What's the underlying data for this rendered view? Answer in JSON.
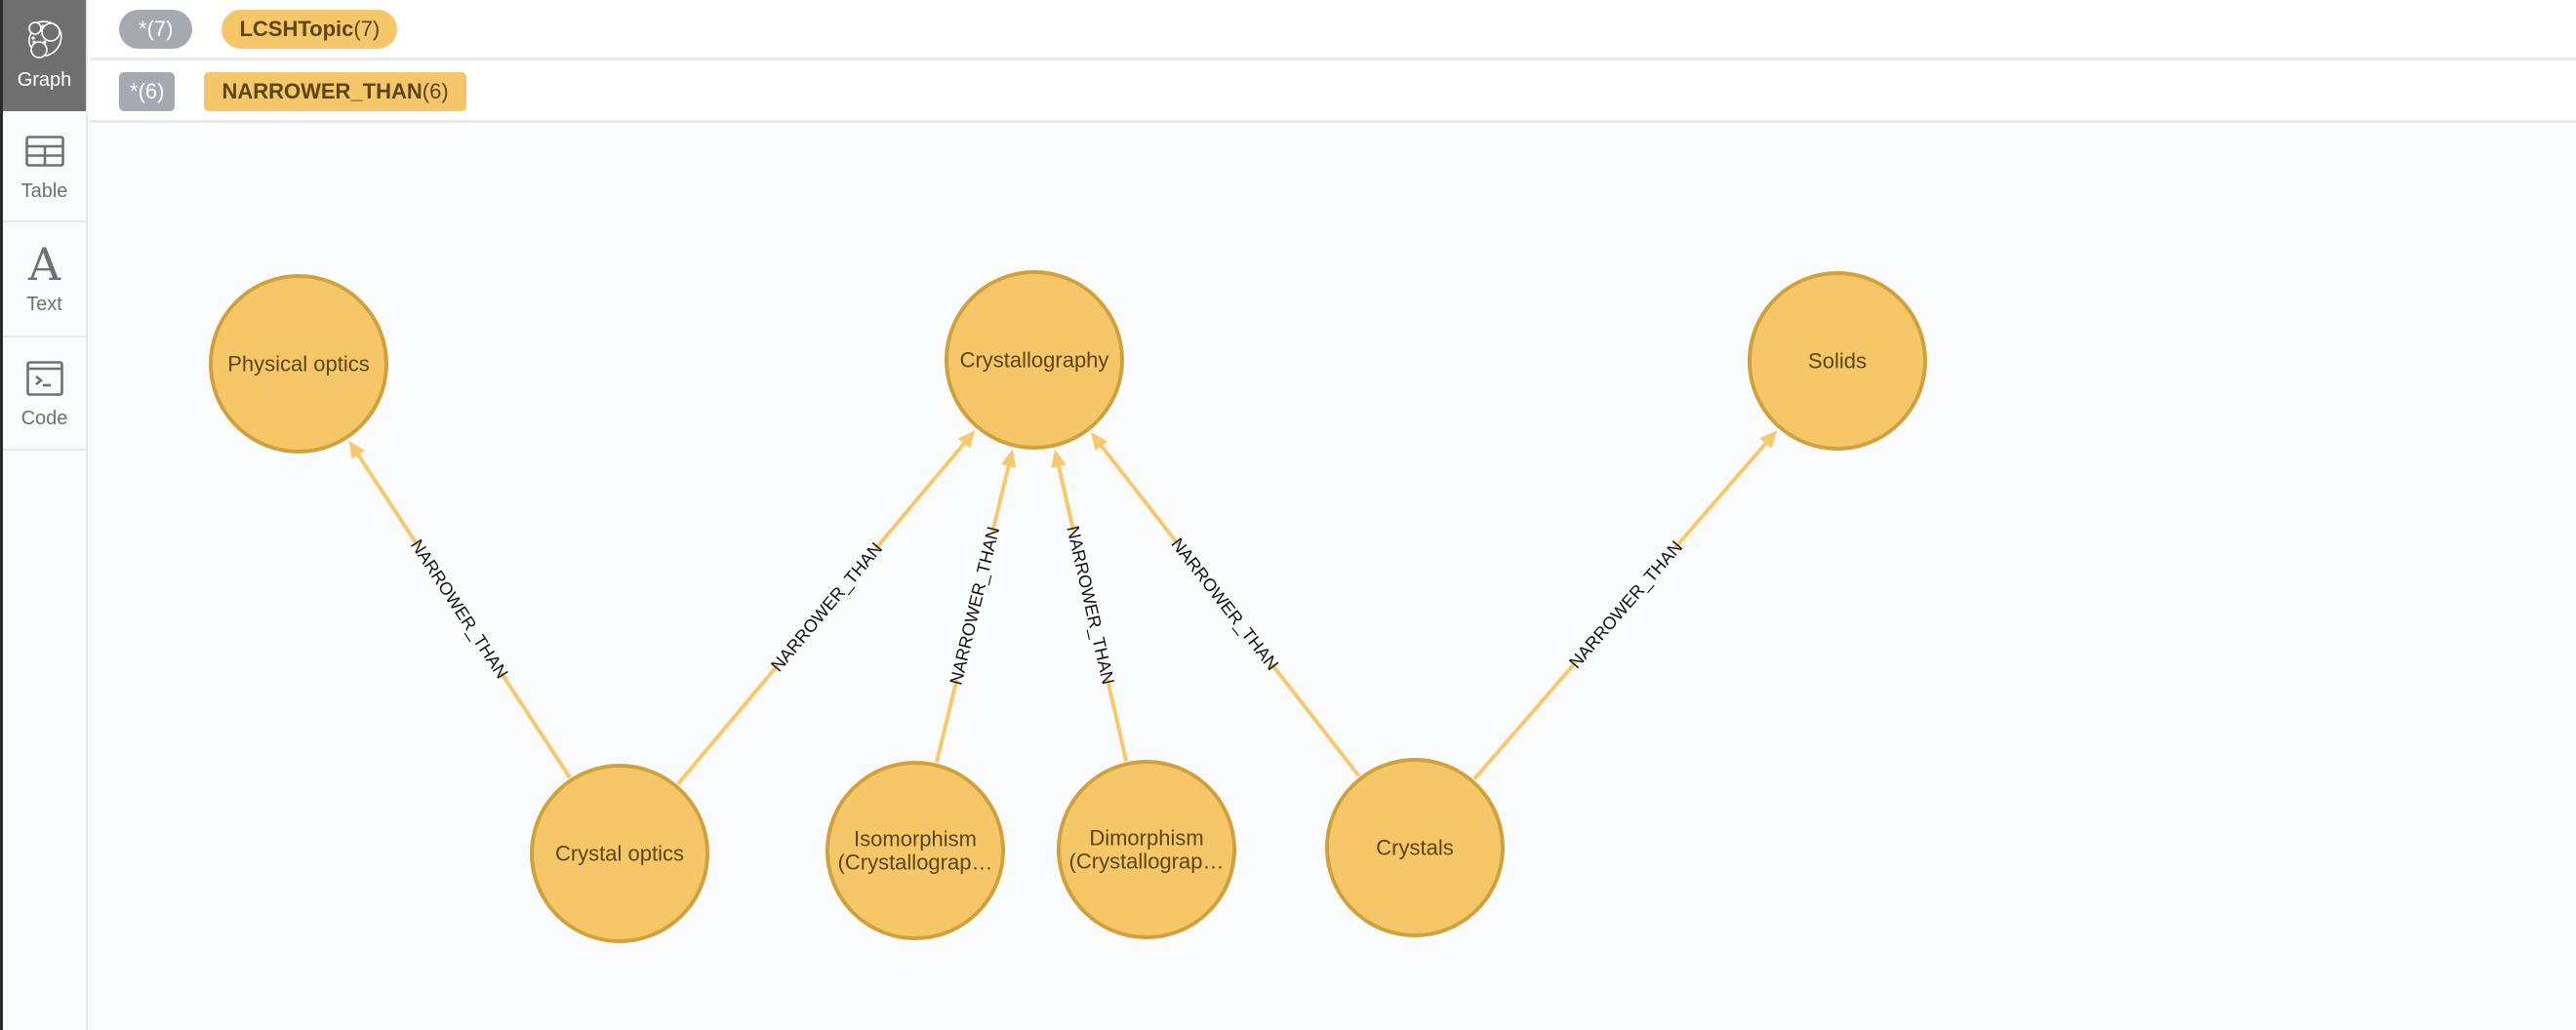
{
  "sidebar": {
    "items": [
      {
        "id": "graph",
        "label": "Graph",
        "icon": "graph-icon",
        "active": true
      },
      {
        "id": "table",
        "label": "Table",
        "icon": "table-icon",
        "active": false
      },
      {
        "id": "text",
        "label": "Text",
        "icon": "text-icon",
        "glyph": "A",
        "active": false
      },
      {
        "id": "code",
        "label": "Code",
        "icon": "code-icon",
        "active": false
      }
    ]
  },
  "header": {
    "node_labels": {
      "all": {
        "label": "*",
        "count": "(7)"
      },
      "items": [
        {
          "label": "LCSHTopic",
          "count": "(7)"
        }
      ]
    },
    "relationship_types": {
      "all": {
        "label": "*",
        "count": "(6)"
      },
      "items": [
        {
          "label": "NARROWER_THAN",
          "count": "(6)"
        }
      ]
    }
  },
  "colors": {
    "node_fill": "#f6c768",
    "node_stroke": "#d1a23b",
    "node_text": "#5a4614",
    "edge": "#f7c96c",
    "edge_text": "#111111",
    "pill_gray": "#a5a9b2",
    "sidebar_active": "#6f6f6f"
  },
  "graph": {
    "nodes": [
      {
        "id": "physical-optics",
        "label": "Physical optics",
        "lines": [
          "Physical optics"
        ]
      },
      {
        "id": "crystallography",
        "label": "Crystallography",
        "lines": [
          "Crystallography"
        ]
      },
      {
        "id": "solids",
        "label": "Solids",
        "lines": [
          "Solids"
        ]
      },
      {
        "id": "crystal-optics",
        "label": "Crystal optics",
        "lines": [
          "Crystal optics"
        ]
      },
      {
        "id": "isomorphism",
        "label": "Isomorphism (Crystallography)",
        "lines": [
          "Isomorphism",
          "(Crystallograp…"
        ]
      },
      {
        "id": "dimorphism",
        "label": "Dimorphism (Crystallography)",
        "lines": [
          "Dimorphism",
          "(Crystallograp…"
        ]
      },
      {
        "id": "crystals",
        "label": "Crystals",
        "lines": [
          "Crystals"
        ]
      }
    ],
    "edges": [
      {
        "from": "crystal-optics",
        "to": "physical-optics",
        "type": "NARROWER_THAN"
      },
      {
        "from": "crystal-optics",
        "to": "crystallography",
        "type": "NARROWER_THAN"
      },
      {
        "from": "isomorphism",
        "to": "crystallography",
        "type": "NARROWER_THAN"
      },
      {
        "from": "dimorphism",
        "to": "crystallography",
        "type": "NARROWER_THAN"
      },
      {
        "from": "crystals",
        "to": "crystallography",
        "type": "NARROWER_THAN"
      },
      {
        "from": "crystals",
        "to": "solids",
        "type": "NARROWER_THAN"
      }
    ]
  }
}
